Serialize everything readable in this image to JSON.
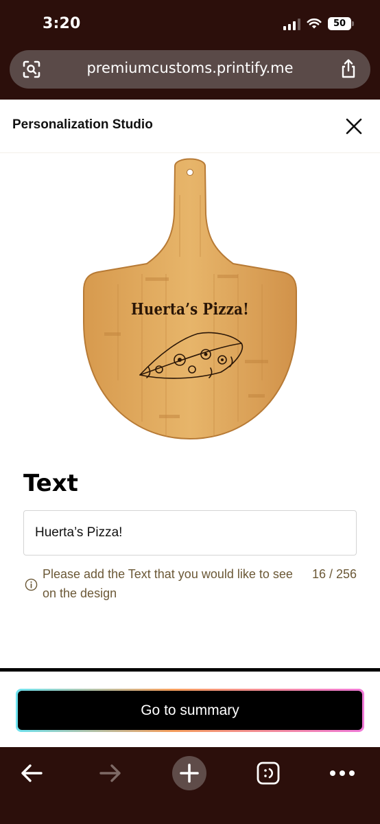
{
  "status_bar": {
    "time": "3:20",
    "battery": "50"
  },
  "browser": {
    "url": "premiumcustoms.printify.me"
  },
  "studio": {
    "title": "Personalization Studio",
    "preview_text": "Huerta’s Pizza!"
  },
  "text_section": {
    "title": "Text",
    "input_value": "Huerta’s Pizza!",
    "helper": "Please add the Text that you would like to see on the design",
    "counter": "16 / 256"
  },
  "actions": {
    "summary_button": "Go to summary"
  },
  "colors": {
    "chrome_background": "#2c0f0b",
    "url_pill": "#5a4a48",
    "board_wood": "#dca055",
    "helper_text": "#6b5836",
    "button_bg": "#000000"
  },
  "icons": {
    "url_left": "page-scan-icon",
    "url_right": "share-icon",
    "close": "close-icon",
    "info": "info-icon",
    "toolbar": [
      "back-arrow-icon",
      "forward-arrow-icon",
      "plus-icon",
      "tabs-icon",
      "more-icon"
    ]
  }
}
